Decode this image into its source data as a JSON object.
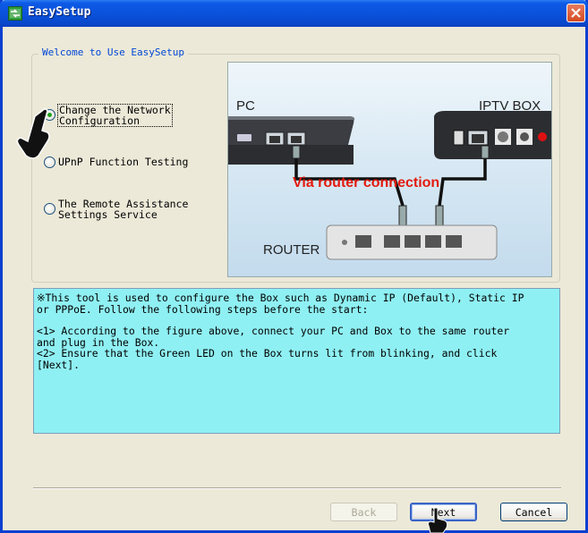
{
  "window": {
    "title": "EasySetup",
    "app_icon": "easysetup-app-icon",
    "close_icon": "close-icon"
  },
  "group": {
    "legend": "Welcome to Use EasySetup"
  },
  "options": [
    {
      "label": "Change the Network\nConfiguration",
      "checked": true
    },
    {
      "label": "UPnP Function Testing",
      "checked": false
    },
    {
      "label": "The Remote Assistance\nSettings Service",
      "checked": false
    }
  ],
  "diagram": {
    "pc_label": "PC",
    "iptv_label": "IPTV BOX",
    "via_label": "Via router connection",
    "router_label": "ROUTER",
    "accent_color": "#e31b0f"
  },
  "info": {
    "intro": "※This tool is used to configure the Box such as Dynamic IP (Default), Static IP\nor PPPoE. Follow the following steps before the start:",
    "step1": "<1> According to the figure above, connect your PC and Box to  the same router\nand plug in the Box.",
    "step2": "<2> Ensure that the Green LED on the Box turns lit from blinking, and click\n[Next].",
    "background_color": "#8ff0f3"
  },
  "buttons": {
    "back": "Back",
    "next": "Next",
    "cancel": "Cancel"
  },
  "cursors": {
    "pointer_icon": "hand-pointer-icon"
  }
}
